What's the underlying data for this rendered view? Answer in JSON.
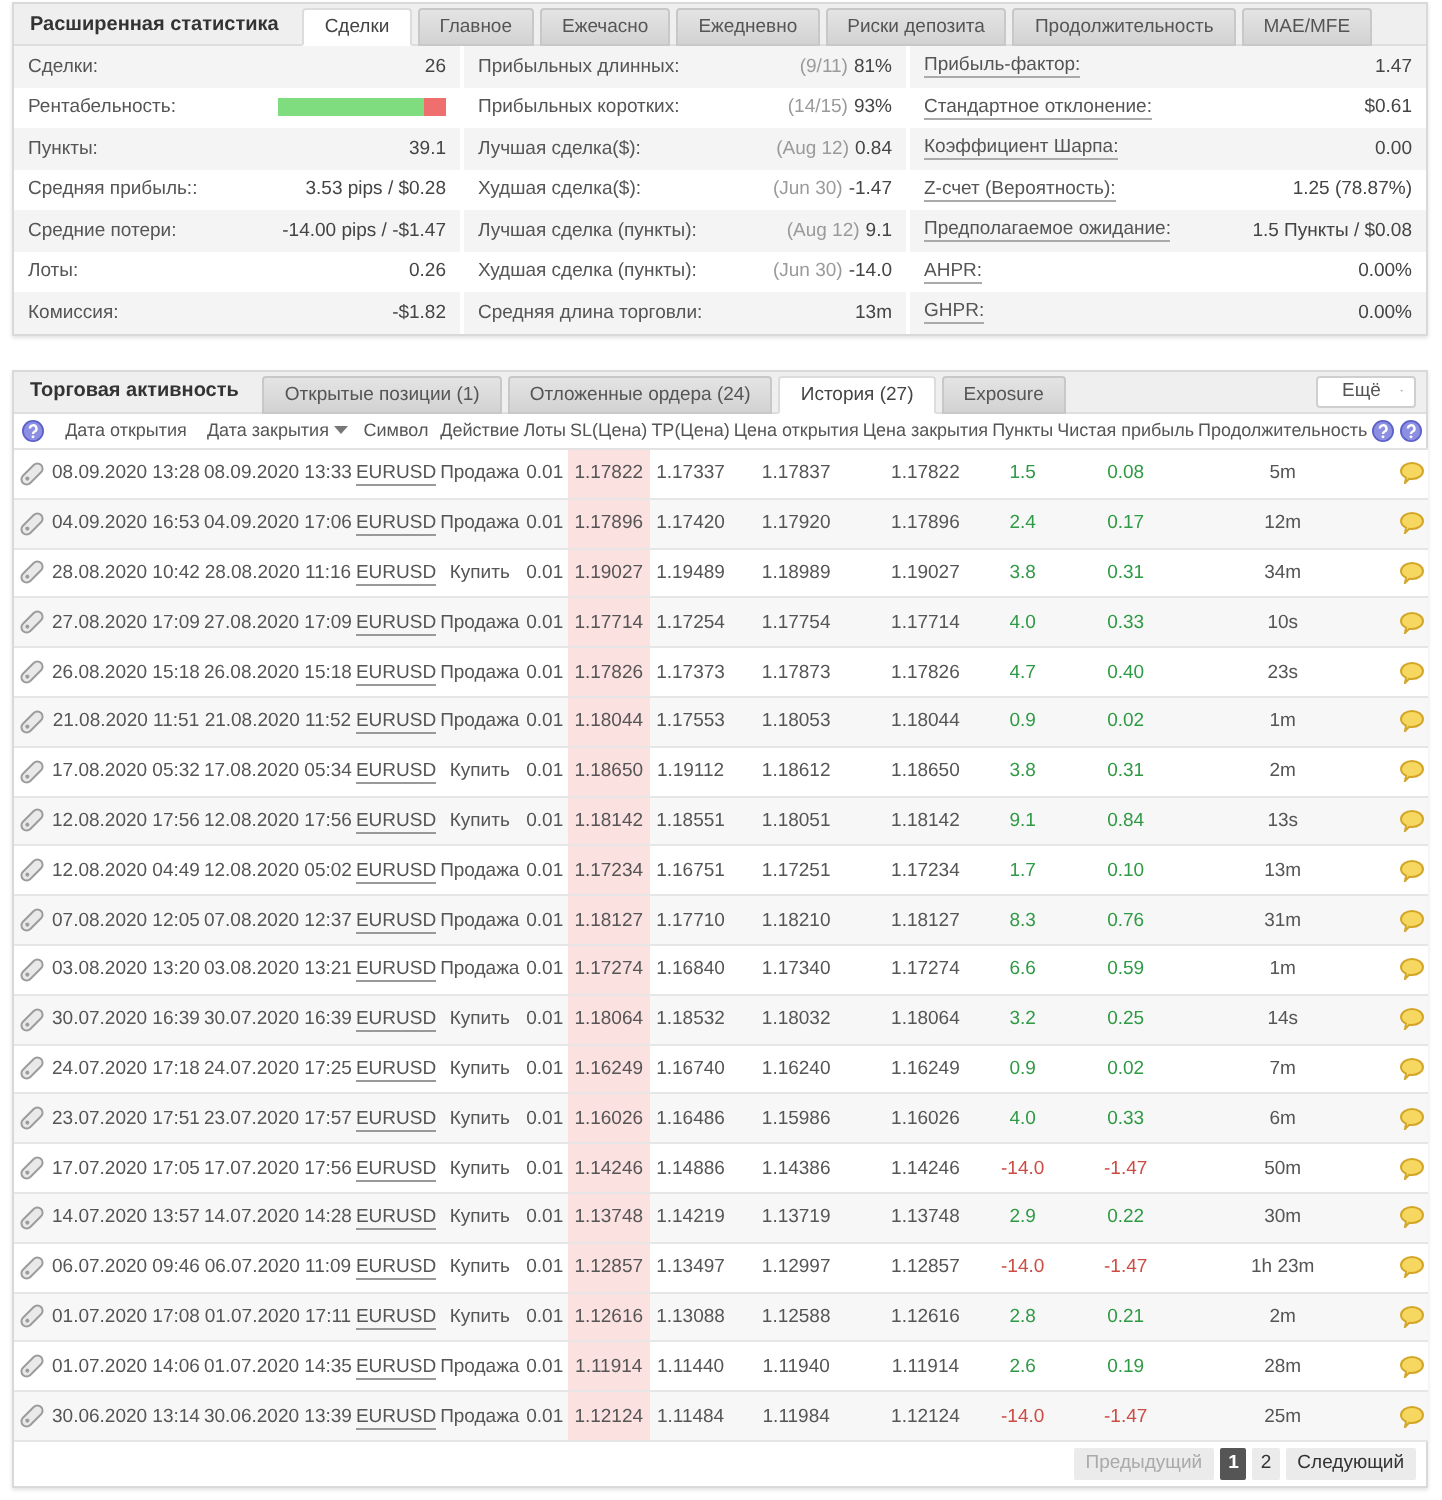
{
  "stats": {
    "title": "Расширенная статистика",
    "tabs": [
      {
        "label": "Сделки",
        "selected": true
      },
      {
        "label": "Главное",
        "selected": false
      },
      {
        "label": "Ежечасно",
        "selected": false
      },
      {
        "label": "Ежедневно",
        "selected": false
      },
      {
        "label": "Риски депозита",
        "selected": false
      },
      {
        "label": "Продолжительность",
        "selected": false
      },
      {
        "label": "MAE/MFE",
        "selected": false
      }
    ],
    "columns": [
      {
        "items": [
          {
            "kind": "text",
            "label": "Сделки:",
            "value": "26"
          },
          {
            "kind": "bar",
            "label": "Рентабельность:",
            "level": 0.87
          },
          {
            "kind": "text",
            "label": "Пункты:",
            "value": "39.1"
          },
          {
            "kind": "text",
            "label": "Средняя прибыль::",
            "value": "3.53 pips / $0.28"
          },
          {
            "kind": "text",
            "label": "Средние потери:",
            "value": "-14.00 pips / -$1.47"
          },
          {
            "kind": "text",
            "label": "Лоты:",
            "value": "0.26"
          },
          {
            "kind": "text",
            "label": "Комиссия:",
            "value": "-$1.82"
          }
        ]
      },
      {
        "items": [
          {
            "kind": "text",
            "label": "Прибыльных длинных:",
            "note": "(9/11)",
            "value": "81%"
          },
          {
            "kind": "text",
            "label": "Прибыльных коротких:",
            "note": "(14/15)",
            "value": "93%"
          },
          {
            "kind": "text",
            "label": "Лучшая сделка($):",
            "note": "(Aug 12)",
            "value": "0.84"
          },
          {
            "kind": "text",
            "label": "Худшая сделка($):",
            "note": "(Jun 30)",
            "value": "-1.47"
          },
          {
            "kind": "text",
            "label": "Лучшая сделка (пункты):",
            "note": "(Aug 12)",
            "value": "9.1"
          },
          {
            "kind": "text",
            "label": "Худшая сделка (пункты):",
            "note": "(Jun 30)",
            "value": "-14.0"
          },
          {
            "kind": "text",
            "label": "Средняя длина торговли:",
            "value": "13m"
          }
        ]
      },
      {
        "items": [
          {
            "kind": "term",
            "label": "Прибыль-фактор:",
            "value": "1.47"
          },
          {
            "kind": "term",
            "label": "Стандартное отклонение:",
            "value": "$0.61"
          },
          {
            "kind": "term",
            "label": "Коэффициент Шарпа:",
            "value": "0.00"
          },
          {
            "kind": "term",
            "label": "Z-счет (Вероятность):",
            "value": "1.25 (78.87%)"
          },
          {
            "kind": "term",
            "label": "Предполагаемое ожидание:",
            "value": "1.5 Пункты / $0.08"
          },
          {
            "kind": "term",
            "label": "AHPR:",
            "value": "0.00%"
          },
          {
            "kind": "term",
            "label": "GHPR:",
            "value": "0.00%"
          }
        ]
      }
    ]
  },
  "activity": {
    "title": "Торговая активность",
    "tabs": [
      {
        "label": "Открытые позиции (1)",
        "selected": false
      },
      {
        "label": "Отложенные ордера (24)",
        "selected": false
      },
      {
        "label": "История (27)",
        "selected": true
      },
      {
        "label": "Exposure",
        "selected": false
      }
    ],
    "more_button": "Ещё",
    "table": {
      "columns": [
        {
          "label": "Дата открытия",
          "sorted": false
        },
        {
          "label": "Дата закрытия",
          "sorted": true
        },
        {
          "label": "Символ",
          "sorted": false
        },
        {
          "label": "Действие",
          "sorted": false
        },
        {
          "label": "Лоты",
          "sorted": false
        },
        {
          "label": "SL(Цена)",
          "sorted": false
        },
        {
          "label": "TP(Цена)",
          "sorted": false
        },
        {
          "label": "Цена открытия",
          "sorted": false
        },
        {
          "label": "Цена закрытия",
          "sorted": false
        },
        {
          "label": "Пункты",
          "sorted": false
        },
        {
          "label": "Чистая прибыль",
          "sorted": false
        },
        {
          "label": "Продолжительность",
          "sorted": false
        }
      ],
      "rows": [
        {
          "open": "08.09.2020 13:28",
          "close": "08.09.2020 13:33",
          "symbol": "EURUSD",
          "action": "Продажа",
          "lots": "0.01",
          "sl": "1.17822",
          "sl_hit": true,
          "tp": "1.17337",
          "open_price": "1.17837",
          "close_price": "1.17822",
          "points": "1.5",
          "profit": "0.08",
          "loss": false,
          "duration": "5m"
        },
        {
          "open": "04.09.2020 16:53",
          "close": "04.09.2020 17:06",
          "symbol": "EURUSD",
          "action": "Продажа",
          "lots": "0.01",
          "sl": "1.17896",
          "sl_hit": true,
          "tp": "1.17420",
          "open_price": "1.17920",
          "close_price": "1.17896",
          "points": "2.4",
          "profit": "0.17",
          "loss": false,
          "duration": "12m"
        },
        {
          "open": "28.08.2020 10:42",
          "close": "28.08.2020 11:16",
          "symbol": "EURUSD",
          "action": "Купить",
          "lots": "0.01",
          "sl": "1.19027",
          "sl_hit": true,
          "tp": "1.19489",
          "open_price": "1.18989",
          "close_price": "1.19027",
          "points": "3.8",
          "profit": "0.31",
          "loss": false,
          "duration": "34m"
        },
        {
          "open": "27.08.2020 17:09",
          "close": "27.08.2020 17:09",
          "symbol": "EURUSD",
          "action": "Продажа",
          "lots": "0.01",
          "sl": "1.17714",
          "sl_hit": true,
          "tp": "1.17254",
          "open_price": "1.17754",
          "close_price": "1.17714",
          "points": "4.0",
          "profit": "0.33",
          "loss": false,
          "duration": "10s"
        },
        {
          "open": "26.08.2020 15:18",
          "close": "26.08.2020 15:18",
          "symbol": "EURUSD",
          "action": "Продажа",
          "lots": "0.01",
          "sl": "1.17826",
          "sl_hit": true,
          "tp": "1.17373",
          "open_price": "1.17873",
          "close_price": "1.17826",
          "points": "4.7",
          "profit": "0.40",
          "loss": false,
          "duration": "23s"
        },
        {
          "open": "21.08.2020 11:51",
          "close": "21.08.2020 11:52",
          "symbol": "EURUSD",
          "action": "Продажа",
          "lots": "0.01",
          "sl": "1.18044",
          "sl_hit": true,
          "tp": "1.17553",
          "open_price": "1.18053",
          "close_price": "1.18044",
          "points": "0.9",
          "profit": "0.02",
          "loss": false,
          "duration": "1m"
        },
        {
          "open": "17.08.2020 05:32",
          "close": "17.08.2020 05:34",
          "symbol": "EURUSD",
          "action": "Купить",
          "lots": "0.01",
          "sl": "1.18650",
          "sl_hit": true,
          "tp": "1.19112",
          "open_price": "1.18612",
          "close_price": "1.18650",
          "points": "3.8",
          "profit": "0.31",
          "loss": false,
          "duration": "2m"
        },
        {
          "open": "12.08.2020 17:56",
          "close": "12.08.2020 17:56",
          "symbol": "EURUSD",
          "action": "Купить",
          "lots": "0.01",
          "sl": "1.18142",
          "sl_hit": true,
          "tp": "1.18551",
          "open_price": "1.18051",
          "close_price": "1.18142",
          "points": "9.1",
          "profit": "0.84",
          "loss": false,
          "duration": "13s"
        },
        {
          "open": "12.08.2020 04:49",
          "close": "12.08.2020 05:02",
          "symbol": "EURUSD",
          "action": "Продажа",
          "lots": "0.01",
          "sl": "1.17234",
          "sl_hit": true,
          "tp": "1.16751",
          "open_price": "1.17251",
          "close_price": "1.17234",
          "points": "1.7",
          "profit": "0.10",
          "loss": false,
          "duration": "13m"
        },
        {
          "open": "07.08.2020 12:05",
          "close": "07.08.2020 12:37",
          "symbol": "EURUSD",
          "action": "Продажа",
          "lots": "0.01",
          "sl": "1.18127",
          "sl_hit": true,
          "tp": "1.17710",
          "open_price": "1.18210",
          "close_price": "1.18127",
          "points": "8.3",
          "profit": "0.76",
          "loss": false,
          "duration": "31m"
        },
        {
          "open": "03.08.2020 13:20",
          "close": "03.08.2020 13:21",
          "symbol": "EURUSD",
          "action": "Продажа",
          "lots": "0.01",
          "sl": "1.17274",
          "sl_hit": true,
          "tp": "1.16840",
          "open_price": "1.17340",
          "close_price": "1.17274",
          "points": "6.6",
          "profit": "0.59",
          "loss": false,
          "duration": "1m"
        },
        {
          "open": "30.07.2020 16:39",
          "close": "30.07.2020 16:39",
          "symbol": "EURUSD",
          "action": "Купить",
          "lots": "0.01",
          "sl": "1.18064",
          "sl_hit": true,
          "tp": "1.18532",
          "open_price": "1.18032",
          "close_price": "1.18064",
          "points": "3.2",
          "profit": "0.25",
          "loss": false,
          "duration": "14s"
        },
        {
          "open": "24.07.2020 17:18",
          "close": "24.07.2020 17:25",
          "symbol": "EURUSD",
          "action": "Купить",
          "lots": "0.01",
          "sl": "1.16249",
          "sl_hit": true,
          "tp": "1.16740",
          "open_price": "1.16240",
          "close_price": "1.16249",
          "points": "0.9",
          "profit": "0.02",
          "loss": false,
          "duration": "7m"
        },
        {
          "open": "23.07.2020 17:51",
          "close": "23.07.2020 17:57",
          "symbol": "EURUSD",
          "action": "Купить",
          "lots": "0.01",
          "sl": "1.16026",
          "sl_hit": true,
          "tp": "1.16486",
          "open_price": "1.15986",
          "close_price": "1.16026",
          "points": "4.0",
          "profit": "0.33",
          "loss": false,
          "duration": "6m"
        },
        {
          "open": "17.07.2020 17:05",
          "close": "17.07.2020 17:56",
          "symbol": "EURUSD",
          "action": "Купить",
          "lots": "0.01",
          "sl": "1.14246",
          "sl_hit": true,
          "tp": "1.14886",
          "open_price": "1.14386",
          "close_price": "1.14246",
          "points": "-14.0",
          "profit": "-1.47",
          "loss": true,
          "duration": "50m"
        },
        {
          "open": "14.07.2020 13:57",
          "close": "14.07.2020 14:28",
          "symbol": "EURUSD",
          "action": "Купить",
          "lots": "0.01",
          "sl": "1.13748",
          "sl_hit": true,
          "tp": "1.14219",
          "open_price": "1.13719",
          "close_price": "1.13748",
          "points": "2.9",
          "profit": "0.22",
          "loss": false,
          "duration": "30m"
        },
        {
          "open": "06.07.2020 09:46",
          "close": "06.07.2020 11:09",
          "symbol": "EURUSD",
          "action": "Купить",
          "lots": "0.01",
          "sl": "1.12857",
          "sl_hit": true,
          "tp": "1.13497",
          "open_price": "1.12997",
          "close_price": "1.12857",
          "points": "-14.0",
          "profit": "-1.47",
          "loss": true,
          "duration": "1h 23m"
        },
        {
          "open": "01.07.2020 17:08",
          "close": "01.07.2020 17:11",
          "symbol": "EURUSD",
          "action": "Купить",
          "lots": "0.01",
          "sl": "1.12616",
          "sl_hit": true,
          "tp": "1.13088",
          "open_price": "1.12588",
          "close_price": "1.12616",
          "points": "2.8",
          "profit": "0.21",
          "loss": false,
          "duration": "2m"
        },
        {
          "open": "01.07.2020 14:06",
          "close": "01.07.2020 14:35",
          "symbol": "EURUSD",
          "action": "Продажа",
          "lots": "0.01",
          "sl": "1.11914",
          "sl_hit": true,
          "tp": "1.11440",
          "open_price": "1.11940",
          "close_price": "1.11914",
          "points": "2.6",
          "profit": "0.19",
          "loss": false,
          "duration": "28m"
        },
        {
          "open": "30.06.2020 13:14",
          "close": "30.06.2020 13:39",
          "symbol": "EURUSD",
          "action": "Продажа",
          "lots": "0.01",
          "sl": "1.12124",
          "sl_hit": true,
          "tp": "1.11484",
          "open_price": "1.11984",
          "close_price": "1.12124",
          "points": "-14.0",
          "profit": "-1.47",
          "loss": true,
          "duration": "25m"
        }
      ]
    },
    "pagination": {
      "previous": {
        "label": "Предыдущий",
        "disabled": true
      },
      "pages": [
        {
          "label": "1",
          "selected": true
        },
        {
          "label": "2",
          "selected": false
        }
      ],
      "next": {
        "label": "Следующий",
        "disabled": false
      }
    }
  }
}
